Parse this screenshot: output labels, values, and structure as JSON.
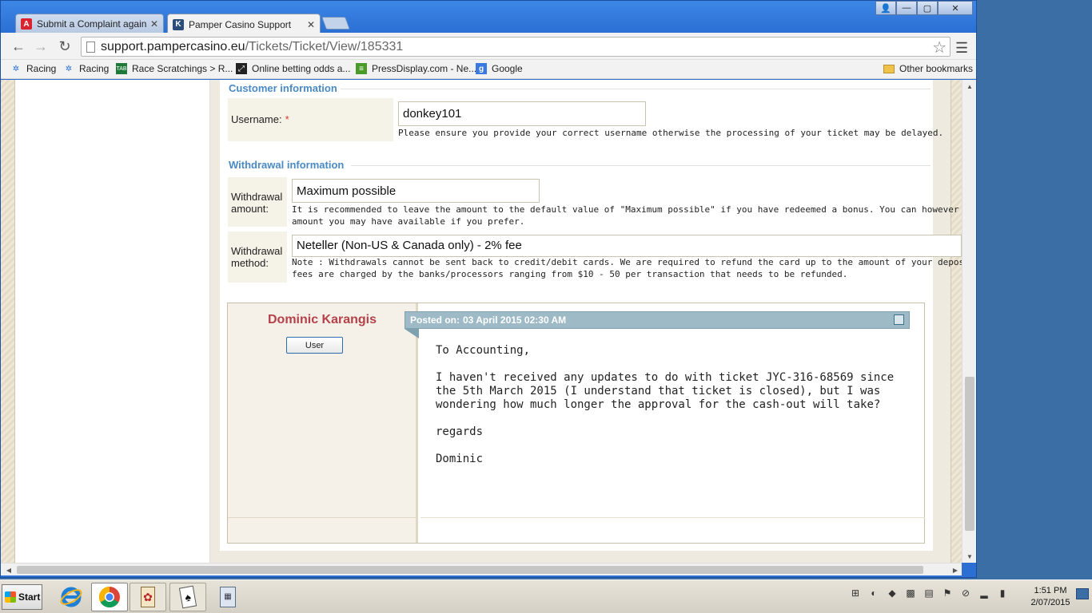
{
  "browser": {
    "tabs": [
      {
        "title": "Submit a Complaint against",
        "favicon": "A",
        "favicon_color": "#d9232e"
      },
      {
        "title": "Pamper Casino Support",
        "favicon": "K",
        "favicon_color": "#2a4d7a"
      }
    ],
    "url": {
      "domain": "support.pampercasino.eu",
      "path": "/Tickets/Ticket/View/185331"
    },
    "bookmarks": [
      {
        "label": "Racing",
        "icon": "star-icon"
      },
      {
        "label": "Racing",
        "icon": "star-icon"
      },
      {
        "label": "Race Scratchings > R...",
        "icon": "tab-icon"
      },
      {
        "label": "Online betting odds a...",
        "icon": "odds-icon"
      },
      {
        "label": "PressDisplay.com - Ne...",
        "icon": "pressdisplay-icon"
      },
      {
        "label": "Google",
        "icon": "google-icon"
      }
    ],
    "other_bookmarks": "Other bookmarks"
  },
  "page": {
    "customer_section": {
      "title": "Customer information",
      "username_label": "Username:",
      "required_mark": "*",
      "username_value": "donkey101",
      "username_help": "Please ensure you provide your correct username otherwise the processing of your ticket may be delayed."
    },
    "withdrawal_section": {
      "title": "Withdrawal information",
      "amount_label_line1": "Withdrawal",
      "amount_label_line2": "amount:",
      "amount_value": "Maximum possible",
      "amount_help_line1": "It is recommended to leave the amount to the default value of \"Maximum possible\" if you have redeemed a bonus. You can however, change it to",
      "amount_help_line2": "amount you may have available if you prefer.",
      "method_label_line1": "Withdrawal",
      "method_label_line2": "method:",
      "method_value": "Neteller (Non-US & Canada only) - 2% fee",
      "method_help_line1": "Note : Withdrawals cannot be sent back to credit/debit cards. We are required to refund the card up to the amount of your deposit(s). Commiserat",
      "method_help_line2": "fees are charged by the banks/processors ranging from $10 - 50 per transaction that needs to be refunded."
    },
    "post": {
      "author": "Dominic Karangis",
      "role": "User",
      "posted_label": "Posted on:",
      "posted_date": "03 April 2015 02:30 AM",
      "body": [
        "To Accounting,",
        "I haven't received any updates to do with ticket JYC-316-68569 since the 5th March 2015 (I understand that ticket is closed), but I was wondering how much longer the approval for the cash-out will take?",
        "regards",
        "Dominic"
      ]
    }
  },
  "taskbar": {
    "start_label": "Start",
    "time": "1:51 PM",
    "date": "2/07/2015"
  }
}
